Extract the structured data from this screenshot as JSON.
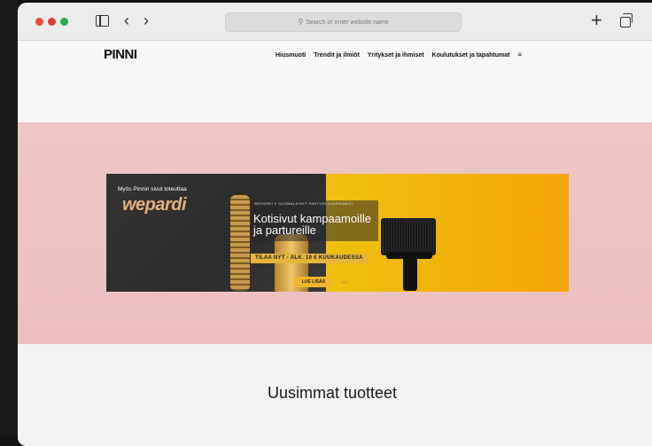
{
  "browser": {
    "address_placeholder": "Search or enter website name",
    "back_glyph": "‹",
    "forward_glyph": "›",
    "new_tab_glyph": "+"
  },
  "site": {
    "logo": "PINNI",
    "nav": [
      "Hiusmuoti",
      "Trendit ja ilmiöt",
      "Yritykset ja ihmiset",
      "Koulutukset ja tapahtumat"
    ],
    "menu_glyph": "≡"
  },
  "banner": {
    "note": "Myös Pinnin sivut toteuttaa",
    "brand": "wepardi",
    "small_caption": "WEPARDI X SUOMALAISET PARTURI-KAMPAAMOT",
    "title_line1": "Kotisivut kampaamoille",
    "title_line2": "ja partureille",
    "offer": "TILAA NYT - ALK. 10 € KUUKAUDESSA",
    "cta": "LUE LISÄÄ"
  },
  "section": {
    "title": "Uusimmat tuotteet"
  }
}
